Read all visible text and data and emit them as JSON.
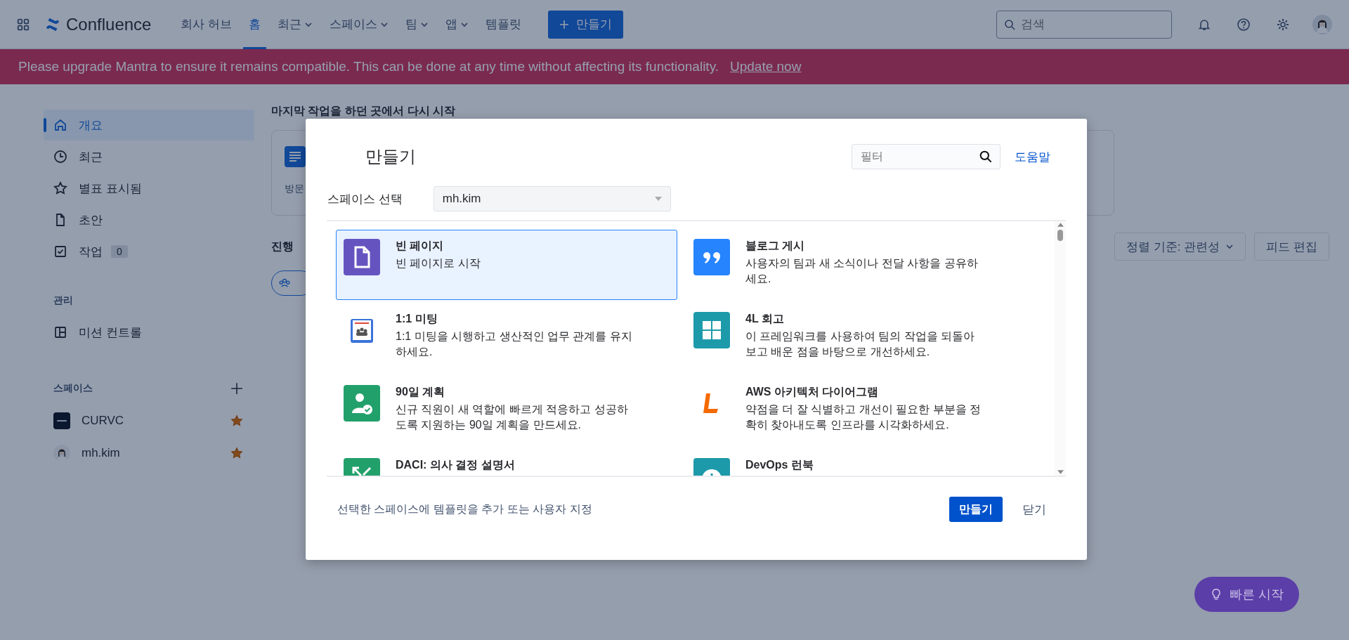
{
  "nav": {
    "app_name": "Confluence",
    "items": [
      {
        "label": "회사 허브",
        "selected": false,
        "dropdown": false
      },
      {
        "label": "홈",
        "selected": true,
        "dropdown": false
      },
      {
        "label": "최근",
        "selected": false,
        "dropdown": true
      },
      {
        "label": "스페이스",
        "selected": false,
        "dropdown": true
      },
      {
        "label": "팀",
        "selected": false,
        "dropdown": true
      },
      {
        "label": "앱",
        "selected": false,
        "dropdown": true
      },
      {
        "label": "템플릿",
        "selected": false,
        "dropdown": false
      }
    ],
    "create_label": "만들기",
    "search_placeholder": "검색"
  },
  "banner": {
    "message": "Please upgrade Mantra to ensure it remains compatible. This can be done at any time without affecting its functionality.",
    "link": "Update now"
  },
  "sidebar": {
    "items": [
      {
        "label": "개요",
        "kind": "home",
        "selected": true
      },
      {
        "label": "최근",
        "kind": "clock",
        "selected": false
      },
      {
        "label": "별표 표시됨",
        "kind": "star",
        "selected": false
      },
      {
        "label": "초안",
        "kind": "file",
        "selected": false
      },
      {
        "label": "작업",
        "kind": "task",
        "selected": false,
        "badge": "0"
      }
    ],
    "manage_heading": "관리",
    "manage_items": [
      {
        "label": "미션 컨트롤",
        "kind": "panel",
        "selected": false
      }
    ],
    "spaces_heading": "스페이스",
    "spaces": [
      {
        "name": "CURVC",
        "kind": "logo",
        "starred": true
      },
      {
        "name": "mh.kim",
        "kind": "person",
        "starred": true
      }
    ]
  },
  "main": {
    "heading": "마지막 작업을 하던 곳에서 다시 시작",
    "card_text": "방문",
    "section": "진행",
    "sort": "정렬 기준: 관련성",
    "edit_feed": "피드 편집"
  },
  "modal": {
    "title": "만들기",
    "filter_placeholder": "필터",
    "help": "도움말",
    "space_label": "스페이스 선택",
    "space_value": "mh.kim",
    "templates": [
      {
        "title": "빈 페이지",
        "description": "빈 페이지로 시작",
        "kind": "page",
        "color": "#6554c0",
        "selected": true
      },
      {
        "title": "블로그 게시",
        "description": "사용자의 팀과 새 소식이나 전달 사항을 공유하세요.",
        "kind": "quote",
        "color": "#2684ff",
        "selected": false
      },
      {
        "title": "1:1 미팅",
        "description": "1:1 미팅을 시행하고 생산적인 업무 관계를 유지하세요.",
        "kind": "meeting",
        "selected": false
      },
      {
        "title": "4L 회고",
        "description": "이 프레임워크를 사용하여 팀의 작업을 되돌아보고 배운 점을 바탕으로 개선하세요.",
        "kind": "grid",
        "color": "#1d9aaa",
        "selected": false
      },
      {
        "title": "90일 계획",
        "description": "신규 직원이 새 역할에 빠르게 적응하고 성공하도록 지원하는 90일 계획을 만드세요.",
        "kind": "plan",
        "color": "#22a06b",
        "selected": false
      },
      {
        "title": "AWS 아키텍처 다이어그램",
        "description": "약점을 더 잘 식별하고 개선이 필요한 부분을 정확히 찾아내도록 인프라를 시각화하세요.",
        "kind": "aws",
        "selected": false
      },
      {
        "title": "DACI: 의사 결정 설명서",
        "kind": "daci",
        "color": "#22a06b",
        "selected": false
      },
      {
        "title": "DevOps 런북",
        "kind": "devops",
        "color": "#1d9aaa",
        "selected": false
      }
    ],
    "footer_link": "선택한 스페이스에 템플릿을 추가 또는 사용자 지정",
    "create": "만들기",
    "close": "닫기"
  },
  "quick_start": "빠른 시작"
}
